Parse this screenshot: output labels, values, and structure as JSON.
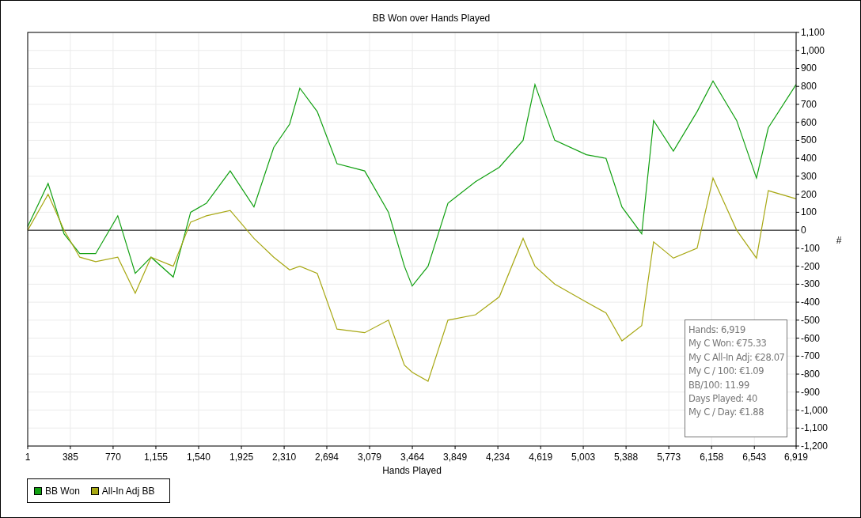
{
  "chart": {
    "chart_data": {
      "type": "line",
      "title": "BB Won over Hands Played",
      "xlabel": "Hands Played",
      "ylabel": "#",
      "x": [
        1,
        185,
        328,
        470,
        613,
        812,
        969,
        1112,
        1311,
        1468,
        1610,
        1824,
        2038,
        2216,
        2359,
        2451,
        2608,
        2786,
        3035,
        3249,
        3392,
        3463,
        3605,
        3784,
        4033,
        4247,
        4461,
        4568,
        4746,
        5031,
        5208,
        5351,
        5529,
        5636,
        5814,
        6028,
        6171,
        6384,
        6562,
        6669,
        6919
      ],
      "series": [
        {
          "name": "BB Won",
          "color": "#11a011",
          "values": [
            20,
            260,
            -20,
            -130,
            -130,
            80,
            -240,
            -150,
            -260,
            100,
            150,
            330,
            130,
            460,
            590,
            790,
            660,
            370,
            330,
            100,
            -200,
            -310,
            -200,
            150,
            270,
            350,
            500,
            810,
            500,
            420,
            400,
            130,
            -20,
            610,
            440,
            660,
            830,
            610,
            290,
            570,
            810
          ]
        },
        {
          "name": "All-In Adj BB",
          "color": "#a8a814",
          "values": [
            0,
            200,
            0,
            -150,
            -175,
            -150,
            -350,
            -150,
            -200,
            45,
            80,
            110,
            -45,
            -150,
            -220,
            -200,
            -240,
            -550,
            -570,
            -500,
            -750,
            -790,
            -840,
            -500,
            -470,
            -370,
            -45,
            -200,
            -300,
            -400,
            -460,
            -615,
            -530,
            -65,
            -155,
            -100,
            290,
            0,
            -155,
            220,
            175
          ]
        }
      ],
      "xlim": [
        1,
        6919
      ],
      "ylim": [
        -1200,
        1100
      ],
      "xticks": [
        1,
        385,
        770,
        {
          "value": 1155,
          "label": "1,155"
        },
        {
          "value": 1540,
          "label": "1,540"
        },
        {
          "value": 1925,
          "label": "1,925"
        },
        {
          "value": 2310,
          "label": "2,310"
        },
        {
          "value": 2694,
          "label": "2,694"
        },
        {
          "value": 3079,
          "label": "3,079"
        },
        {
          "value": 3464,
          "label": "3,464"
        },
        {
          "value": 3849,
          "label": "3,849"
        },
        {
          "value": 4234,
          "label": "4,234"
        },
        {
          "value": 4619,
          "label": "4,619"
        },
        {
          "value": 5003,
          "label": "5,003"
        },
        {
          "value": 5388,
          "label": "5,388"
        },
        {
          "value": 5773,
          "label": "5,773"
        },
        {
          "value": 6158,
          "label": "6,158"
        },
        {
          "value": 6543,
          "label": "6,543"
        },
        {
          "value": 6919,
          "label": "6,919"
        }
      ],
      "yticks": [
        {
          "value": -1200,
          "label": "-1,200"
        },
        {
          "value": -1100,
          "label": "-1,100"
        },
        {
          "value": -1000,
          "label": "-1,000"
        },
        -900,
        -800,
        -700,
        -600,
        -500,
        -400,
        -300,
        -200,
        -100,
        0,
        100,
        200,
        300,
        400,
        500,
        600,
        700,
        800,
        900,
        {
          "value": 1000,
          "label": "1,000"
        },
        {
          "value": 1100,
          "label": "1,100"
        }
      ],
      "grid": true,
      "legend": true
    }
  },
  "stats": [
    "Hands: 6,919",
    "My C Won: €75.33",
    "My C All-In Adj: €28.07",
    "My C / 100: €1.09",
    "BB/100: 11.99",
    "Days Played: 40",
    "My C / Day: €1.88"
  ]
}
